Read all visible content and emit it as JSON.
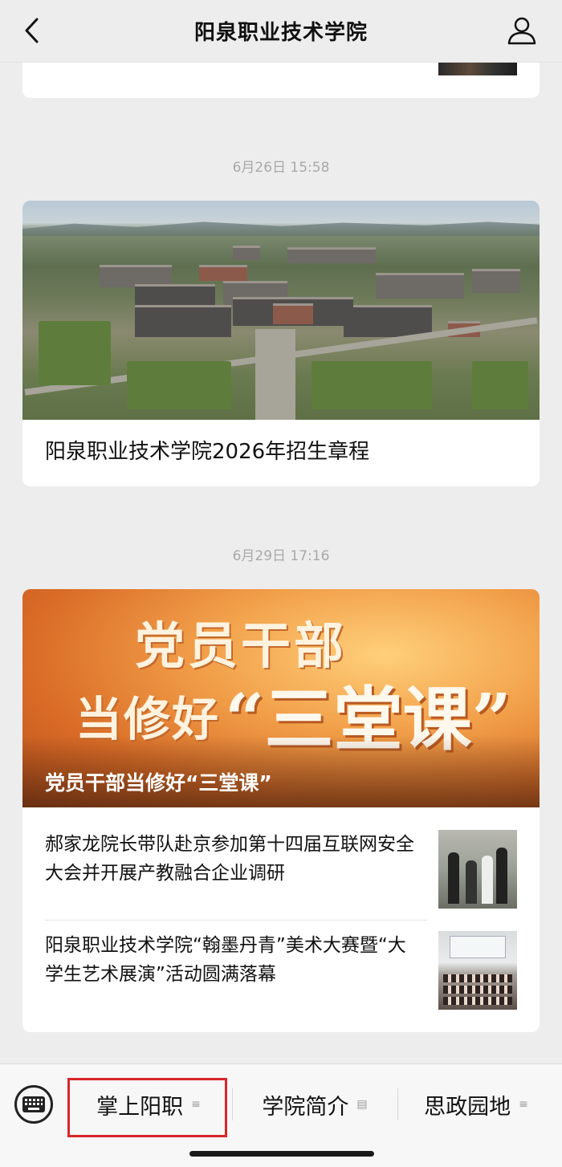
{
  "topbar": {
    "title": "阳泉职业技术学院",
    "back_icon": "chevron-left-icon",
    "user_icon": "user-icon"
  },
  "feed": [
    {
      "time": "6月26日 15:58",
      "cover_caption": "阳泉职业技术学院2026年招生章程"
    },
    {
      "time": "6月29日 17:16",
      "cover": {
        "headline_line1": "党员干部",
        "headline_line2": "当修好",
        "headline_quote": "“三堂课”",
        "overlay_title": "党员干部当修好“三堂课”"
      },
      "items": [
        {
          "text": "郝家龙院长带队赴京参加第十四届互联网安全大会并开展产教融合企业调研"
        },
        {
          "text": "阳泉职业技术学院“翰墨丹青”美术大赛暨“大学生艺术展演”活动圆满落幕"
        }
      ]
    }
  ],
  "menubar": {
    "keyboard_icon": "keyboard-icon",
    "items": [
      {
        "label": "掌上阳职",
        "icon": "≡"
      },
      {
        "label": "学院简介",
        "icon": "▤"
      },
      {
        "label": "思政园地",
        "icon": "≡"
      }
    ],
    "highlight_color": "#d8262a"
  }
}
